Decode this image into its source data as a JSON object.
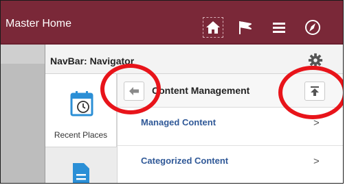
{
  "header": {
    "title": "Master Home",
    "icons": [
      "home-icon",
      "flag-icon",
      "menu-icon",
      "compass-icon"
    ],
    "color": "#7a2838"
  },
  "navbar": {
    "title": "NavBar: Navigator",
    "gear_icon": "gear-icon"
  },
  "rail": {
    "items": [
      {
        "label": "Recent Places",
        "icon": "calendar-clock-icon"
      },
      {
        "label": "",
        "icon": "document-icon"
      }
    ]
  },
  "content": {
    "title": "Content Management",
    "back_icon": "arrow-left-icon",
    "top_icon": "arrow-to-top-icon",
    "rows": [
      {
        "label": "Managed Content",
        "chevron": ">"
      },
      {
        "label": "Categorized Content",
        "chevron": ">"
      }
    ]
  },
  "annotation_color": "#e8141a"
}
